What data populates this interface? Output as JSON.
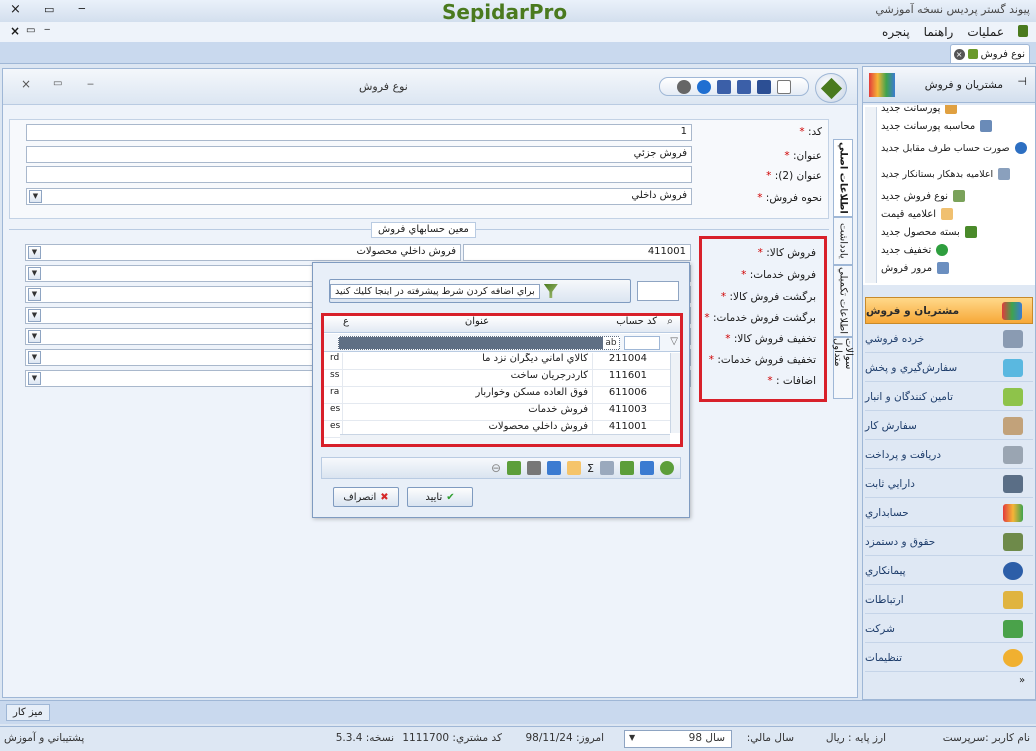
{
  "window": {
    "app_title": "پيوند گستر پرديس نسخه آموزشي",
    "logo": "SepidarPro",
    "close": "×",
    "restore": "▭",
    "minimize": "‒"
  },
  "mdi_controls": {
    "close": "×",
    "restore": "▭",
    "minimize": "‒"
  },
  "menu": [
    "عمليات",
    "راهنما",
    "پنجره"
  ],
  "doc_tab": {
    "label": "نوع فروش",
    "close": "×"
  },
  "panel": {
    "title": "نوع فروش",
    "close": "×",
    "restore": "▭",
    "minimize": "‒"
  },
  "general": {
    "code_label": "كد:",
    "code_value": "1",
    "title_label": "عنوان:",
    "title_value": "فروش جزئي",
    "title2_label": "عنوان (2):",
    "title2_value": "",
    "method_label": "نحوه فروش:",
    "method_value": "فروش داخلي"
  },
  "vtabs": [
    "اطلاعات اصلي",
    "يادداشت",
    "اطلاعات تكميلي",
    "سوالات متداول"
  ],
  "accounts": {
    "section_label": "معين حسابهاي فروش",
    "labels": [
      "فروش كالا:",
      "فروش خدمات:",
      "برگشت فروش كالا:",
      "برگشت فروش خدمات:",
      "تخفيف فروش كالا:",
      "تخفيف فروش خدمات:",
      "اضافات :"
    ],
    "row1_code": "411001",
    "row1_name": "فروش  داخلي محصولات"
  },
  "popup": {
    "filter_hint": "براي اضافه كردن شرط پيشرفته در اينجا كليك كنيد",
    "col_code": "كد حساب",
    "col_title": "عنوان",
    "col_extra": "ع",
    "rows": [
      {
        "code": "211004",
        "title": "كالاي اماني ديگران نزد ما",
        "extra": "rd"
      },
      {
        "code": "111601",
        "title": "كاردرجريان ساخت",
        "extra": "ss"
      },
      {
        "code": "611006",
        "title": "فوق العاده مسكن وخواربار",
        "extra": "ra"
      },
      {
        "code": "411003",
        "title": "فروش خدمات",
        "extra": "es"
      },
      {
        "code": "411001",
        "title": "فروش  داخلي محصولات",
        "extra": "es"
      }
    ],
    "ok": "تاييد",
    "cancel": "انصراف"
  },
  "sidebar": {
    "header": "مشتريان و فروش",
    "modules": [
      "پورسانت جديد",
      "محاسبه پورسانت جديد",
      "صورت حساب طرف مقابل جديد",
      "اعلاميه بدهكار بستانكار جديد",
      "نوع فروش جديد",
      "اعلاميه قيمت",
      "بسته محصول جديد",
      "تخفيف جديد",
      "مرور فروش"
    ],
    "nav": [
      "مشتريان و فروش",
      "خرده فروشي",
      "سفارش‌گيري و پخش",
      "تامين كنندگان و انبار",
      "سفارش كار",
      "دريافت و پرداخت",
      "دارايي ثابت",
      "حسابداري",
      "حقوق و دستمزد",
      "پيمانكاري",
      "ارتباطات",
      "شركت",
      "تنظيمات"
    ]
  },
  "desk_tab": "ميز كار",
  "status": {
    "user": "نام كاربر :سرپرست",
    "base_currency": "ارز پايه :   ريال",
    "fiscal_year_label": "سال مالي:",
    "fiscal_year": "سال 98",
    "today": "امروز:   98/11/24",
    "customer_code": "كد مشتري:   1111700",
    "version": "نسخه:   5.3.4",
    "support": "پشتيباني و آموزش"
  },
  "colors": {
    "accent_orange": "#f7a838",
    "red_highlight": "#d8202a",
    "brand_green": "#4a7a1e"
  }
}
